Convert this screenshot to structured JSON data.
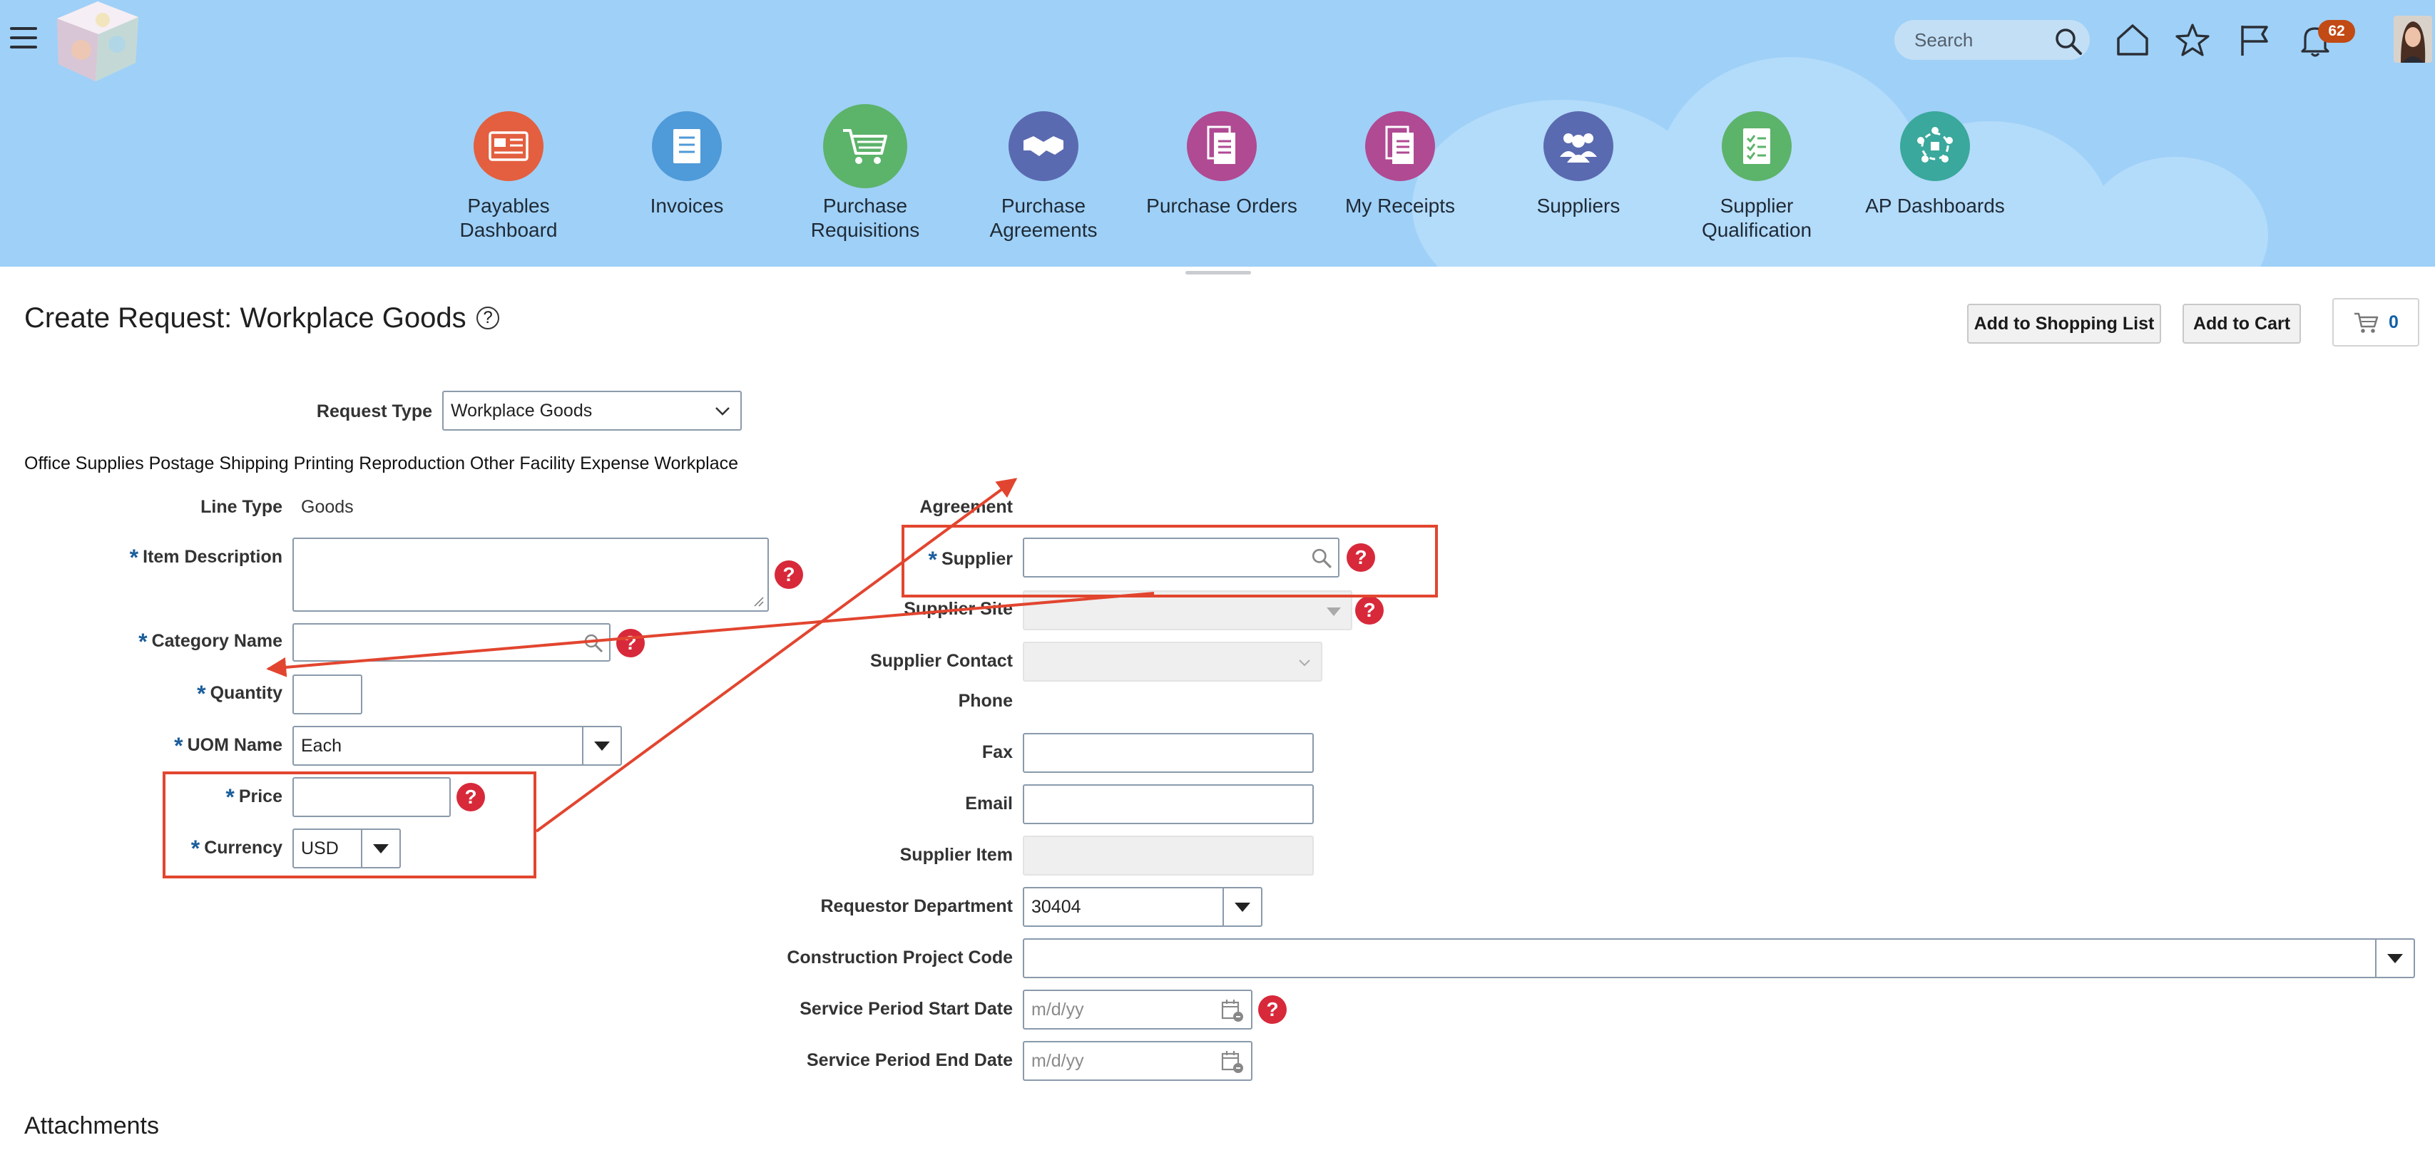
{
  "header": {
    "search_placeholder": "Search",
    "notification_count": "62"
  },
  "nav": [
    {
      "label": "Payables Dashboard",
      "color": "#e35f3f"
    },
    {
      "label": "Invoices",
      "color": "#4f9ad8"
    },
    {
      "label": "Purchase Requisitions",
      "color": "#5cb36a"
    },
    {
      "label": "Purchase Agreements",
      "color": "#5a6ab0"
    },
    {
      "label": "Purchase Orders",
      "color": "#b04a93"
    },
    {
      "label": "My Receipts",
      "color": "#b04a93"
    },
    {
      "label": "Suppliers",
      "color": "#5a6ab0"
    },
    {
      "label": "Supplier Qualification",
      "color": "#5cb36a"
    },
    {
      "label": "AP Dashboards",
      "color": "#3aa89c"
    }
  ],
  "page": {
    "title": "Create Request: Workplace Goods",
    "add_to_shopping_list": "Add to Shopping List",
    "add_to_cart": "Add to Cart",
    "cart_count": "0",
    "description": "Office Supplies Postage Shipping Printing Reproduction Other Facility Expense Workplace",
    "attachments": "Attachments"
  },
  "form": {
    "request_type_label": "Request Type",
    "request_type_value": "Workplace Goods",
    "line_type_label": "Line Type",
    "line_type_value": "Goods",
    "item_description_label": "Item Description",
    "category_name_label": "Category Name",
    "quantity_label": "Quantity",
    "uom_name_label": "UOM Name",
    "uom_name_value": "Each",
    "price_label": "Price",
    "currency_label": "Currency",
    "currency_value": "USD",
    "agreement_label": "Agreement",
    "supplier_label": "Supplier",
    "supplier_site_label": "Supplier Site",
    "supplier_contact_label": "Supplier Contact",
    "phone_label": "Phone",
    "fax_label": "Fax",
    "email_label": "Email",
    "supplier_item_label": "Supplier Item",
    "requestor_department_label": "Requestor Department",
    "requestor_department_value": "30404",
    "construction_project_code_label": "Construction Project Code",
    "service_start_label": "Service Period Start Date",
    "service_end_label": "Service Period End Date",
    "date_placeholder": "m/d/yy"
  },
  "colors": {
    "banner": "#9fd0f7",
    "required_star": "#1b5e9c",
    "help_icon": "#d7293a",
    "annotation": "#e2452f"
  }
}
